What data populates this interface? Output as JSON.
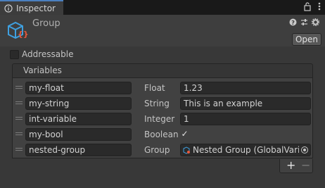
{
  "tab": {
    "title": "Inspector",
    "lock_icon": "lock-icon",
    "menu_icon": "kebab-menu-icon"
  },
  "header": {
    "object_name": "Group",
    "object_icon": "variables-group-asset-icon",
    "help_icon": "help-icon",
    "presets_icon": "presets-icon",
    "settings_icon": "gear-icon",
    "open_label": "Open"
  },
  "addressable": {
    "label": "Addressable",
    "checked": false
  },
  "variables": {
    "title": "Variables",
    "rows": [
      {
        "name": "my-float",
        "type": "Float",
        "value": "1.23"
      },
      {
        "name": "my-string",
        "type": "String",
        "value": "This is an example"
      },
      {
        "name": "int-variable",
        "type": "Integer",
        "value": "1"
      },
      {
        "name": "my-bool",
        "type": "Boolean",
        "checked": true,
        "check_glyph": "✓"
      },
      {
        "name": "nested-group",
        "type": "Group",
        "value": "Nested Group (GlobalVariablesGroup)"
      }
    ],
    "add_label": "+",
    "remove_label": "−"
  }
}
